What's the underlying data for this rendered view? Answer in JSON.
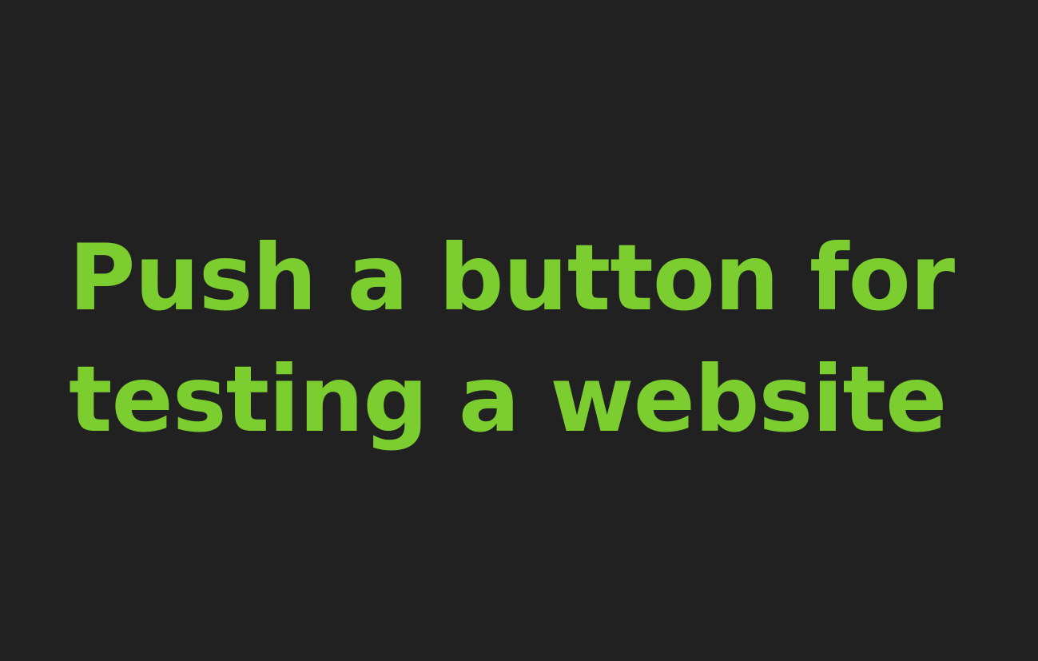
{
  "headline": {
    "lines": [
      "Push a button for",
      "testing a website"
    ]
  },
  "colors": {
    "background": "#212121",
    "text": "#7ccd2f"
  }
}
